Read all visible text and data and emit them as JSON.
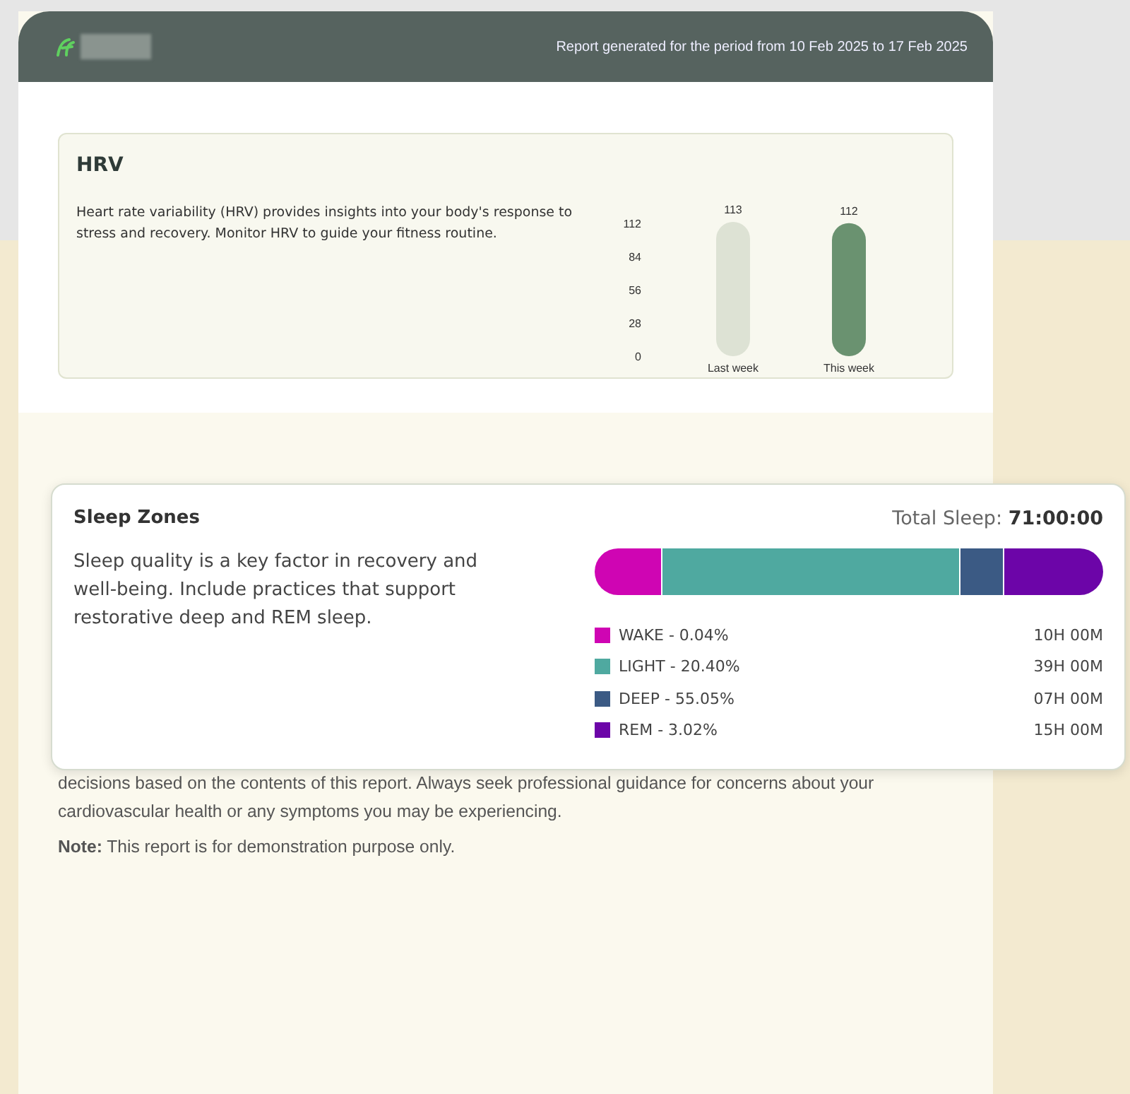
{
  "header": {
    "period_text": "Report generated for the period from 10 Feb 2025 to 17 Feb 2025"
  },
  "hrv": {
    "title": "HRV",
    "description": "Heart rate variability (HRV) provides insights into your body's response to stress and recovery. Monitor HRV to guide your fitness routine.",
    "chart_data": {
      "type": "bar",
      "categories": [
        "Last week",
        "This week"
      ],
      "series": [
        {
          "color": "#dde2d4",
          "values": [
            113,
            null
          ]
        },
        {
          "color": "#6a9270",
          "values": [
            null,
            112
          ]
        }
      ],
      "ylim": [
        0,
        113
      ],
      "yticks": [
        0,
        28,
        56,
        84,
        112
      ],
      "data_labels": true
    }
  },
  "sleep_zones": {
    "title": "Sleep Zones",
    "total": "Total Sleep: **71:00:00**",
    "description": "Sleep quality is a key factor in recovery and well-being. Include practices that support restorative deep and REM sleep.",
    "segments": [
      {
        "label": "WAKE - 0.04%",
        "duration": "10H 00M",
        "color": "#cf05b3"
      },
      {
        "label": "LIGHT - 20.40%",
        "duration": "39H 00M",
        "color": "#4fa9a0"
      },
      {
        "label": "DEEP - 55.05%",
        "duration": "07H 00M",
        "color": "#3b5a84"
      },
      {
        "label": "REM - 3.02%",
        "duration": "15H 00M",
        "color": "#6c05a8"
      }
    ]
  },
  "disclaimer": {
    "text": "decisions based on the contents of this report. Always seek professional guidance for concerns about your cardiovascular health or any symptoms you may be experiencing.",
    "note": "**Note:** This report is for demonstration purpose only."
  }
}
